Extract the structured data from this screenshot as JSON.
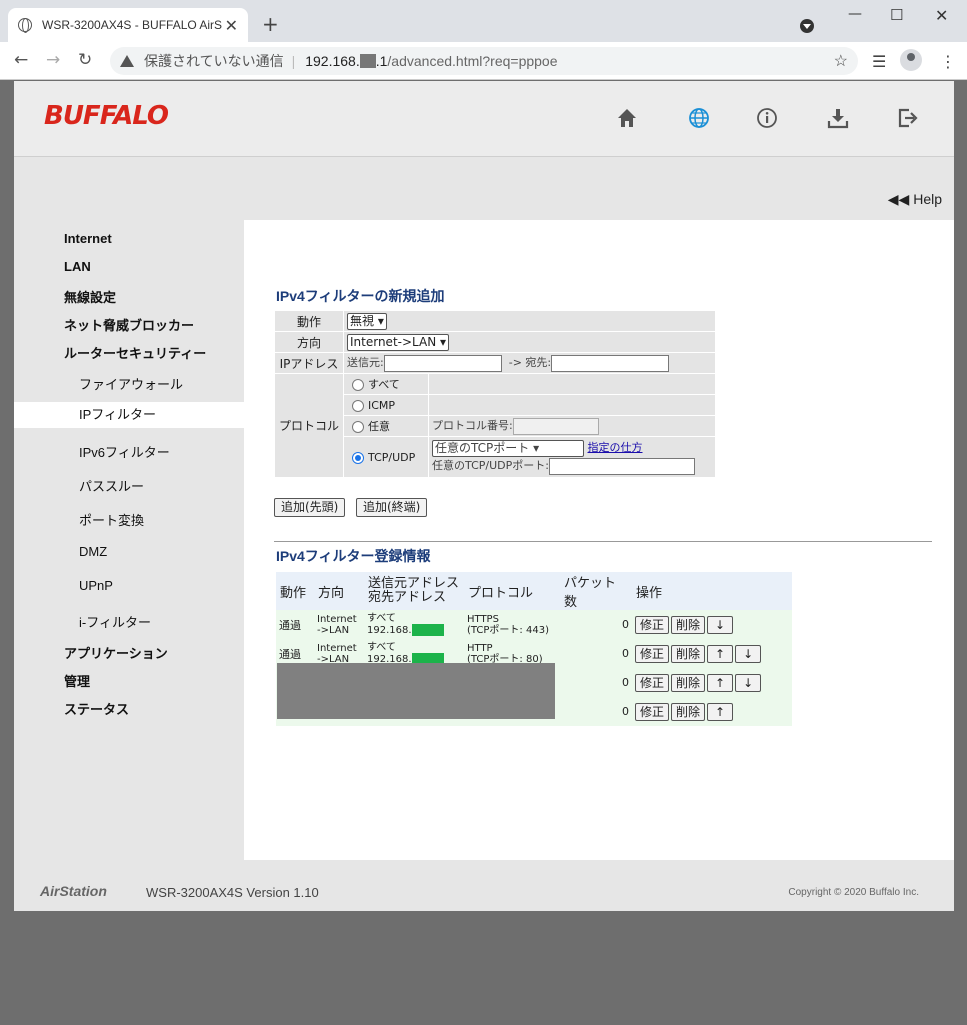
{
  "browser": {
    "tab_title": "WSR-3200AX4S - BUFFALO AirStation",
    "tab_close": "✕",
    "new_tab": "+",
    "security_label": "保護されていない通信",
    "url_host_prefix": "192.168.",
    "url_host_suffix": ".1",
    "url_path": "/advanced.html?req=pppoe"
  },
  "header": {
    "logo": "BUFFALO",
    "help": "◀◀ Help"
  },
  "sidebar": {
    "internet": "Internet",
    "lan": "LAN",
    "wireless": "無線設定",
    "threat_blocker": "ネット脅威ブロッカー",
    "router_security": "ルーターセキュリティー",
    "firewall": "ファイアウォール",
    "ip_filter": "IPフィルター",
    "ipv6_filter": "IPv6フィルター",
    "passthrough": "パススルー",
    "port_forward": "ポート変換",
    "dmz": "DMZ",
    "upnp": "UPnP",
    "i_filter": "i-フィルター",
    "application": "アプリケーション",
    "management": "管理",
    "status": "ステータス"
  },
  "add_form": {
    "title": "IPv4フィルターの新規追加",
    "action_label": "動作",
    "action_value": "無視",
    "direction_label": "方向",
    "direction_value": "Internet->LAN",
    "ip_label": "IPアドレス",
    "src_label": "送信元:",
    "dst_label": "-> 宛先:",
    "protocol_label": "プロトコル",
    "opt_all": "すべて",
    "opt_icmp": "ICMP",
    "opt_any": "任意",
    "proto_num_label": "プロトコル番号:",
    "opt_tcpudp": "TCP/UDP",
    "port_select": "任意のTCPポート",
    "howto_link": "指定の仕方",
    "port_label": "任意のTCP/UDPポート:",
    "add_first": "追加(先頭)",
    "add_last": "追加(終端)"
  },
  "list": {
    "title": "IPv4フィルター登録情報",
    "headers": {
      "action": "動作",
      "direction": "方向",
      "address": "送信元アドレス\n宛先アドレス",
      "protocol": "プロトコル",
      "packets": "パケット数",
      "ops": "操作"
    },
    "rows": [
      {
        "action": "通過",
        "dir1": "Internet",
        "dir2": "->LAN",
        "src": "すべて",
        "dst": "192.168.",
        "proto1": "HTTPS",
        "proto2": "(TCPポート: 443)",
        "packets": "0"
      },
      {
        "action": "通過",
        "dir1": "Internet",
        "dir2": "->LAN",
        "src": "すべて",
        "dst": "192.168.",
        "proto1": "HTTP",
        "proto2": "(TCPポート: 80)",
        "packets": "0"
      },
      {
        "packets": "0"
      },
      {
        "packets": "0"
      }
    ],
    "btn_edit": "修正",
    "btn_delete": "削除",
    "btn_down": "↓",
    "btn_up": "↑"
  },
  "footer": {
    "brand": "AirStation",
    "model": "WSR-3200AX4S  Version 1.10",
    "copyright": "Copyright © 2020 Buffalo Inc."
  }
}
